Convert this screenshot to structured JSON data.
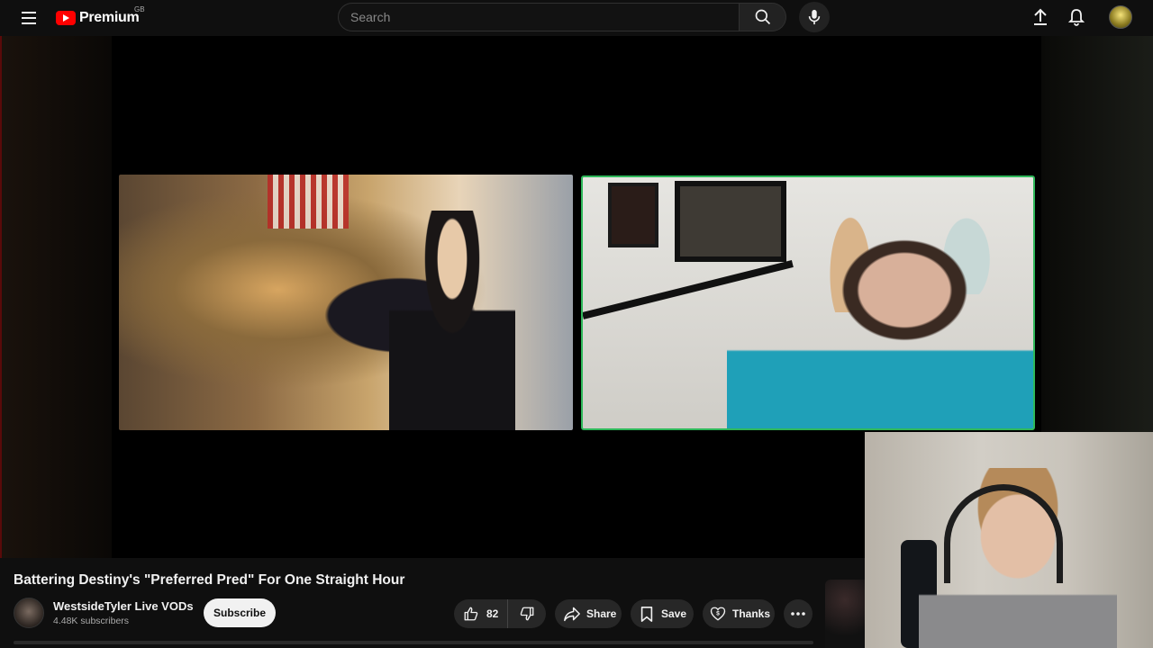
{
  "header": {
    "logo_text": "Premium",
    "region_code": "GB",
    "search_placeholder": "Search"
  },
  "video": {
    "title": "Battering Destiny's \"Preferred Pred\" For One Straight Hour",
    "channel": {
      "name": "WestsideTyler Live VODs",
      "subscribers": "4.48K subscribers"
    },
    "subscribe_label": "Subscribe",
    "actions": {
      "like_count": "82",
      "share_label": "Share",
      "save_label": "Save",
      "thanks_label": "Thanks"
    }
  },
  "colors": {
    "background": "#0f0f0f",
    "brand_red": "#ff0000",
    "active_speaker_border": "#2fb85a",
    "pill_bg": "#272727"
  },
  "icons": [
    "menu-icon",
    "youtube-logo-icon",
    "search-icon",
    "mic-icon",
    "upload-icon",
    "bell-icon",
    "like-icon",
    "dislike-icon",
    "share-icon",
    "save-icon",
    "thanks-icon",
    "more-icon"
  ]
}
